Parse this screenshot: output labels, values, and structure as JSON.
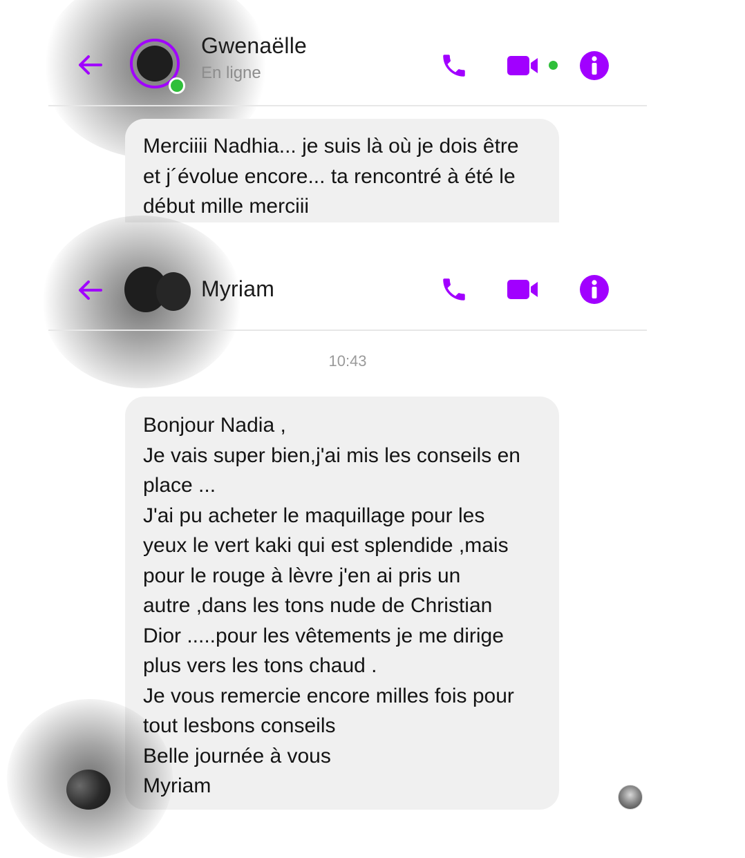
{
  "chat1": {
    "contact_name": "Gwenaëlle",
    "status": "En ligne",
    "message": "Merciiii Nadhia... je suis là où je dois être\net j´évolue encore... ta rencontré à été le\ndébut mille merciii"
  },
  "chat2": {
    "contact_name": "Myriam",
    "timestamp": "10:43",
    "message": "Bonjour Nadia ,\nJe vais super bien,j'ai mis les conseils en\nplace ...\nJ'ai pu acheter le maquillage pour les\nyeux le vert kaki qui est splendide ,mais\npour le rouge à lèvre j'en ai pris un\nautre ,dans les tons nude de Christian\nDior .....pour les vêtements je me dirige\nplus vers les tons chaud .\nJe vous remercie encore milles fois pour\ntout lesbons conseils\nBelle journée à vous\nMyriam"
  },
  "icons": {
    "back": "arrow-left-icon",
    "call": "phone-icon",
    "video": "video-camera-icon",
    "info": "info-icon"
  },
  "colors": {
    "accent": "#a100ff",
    "online": "#2fbf3a",
    "bubble": "#f0f0f0"
  }
}
